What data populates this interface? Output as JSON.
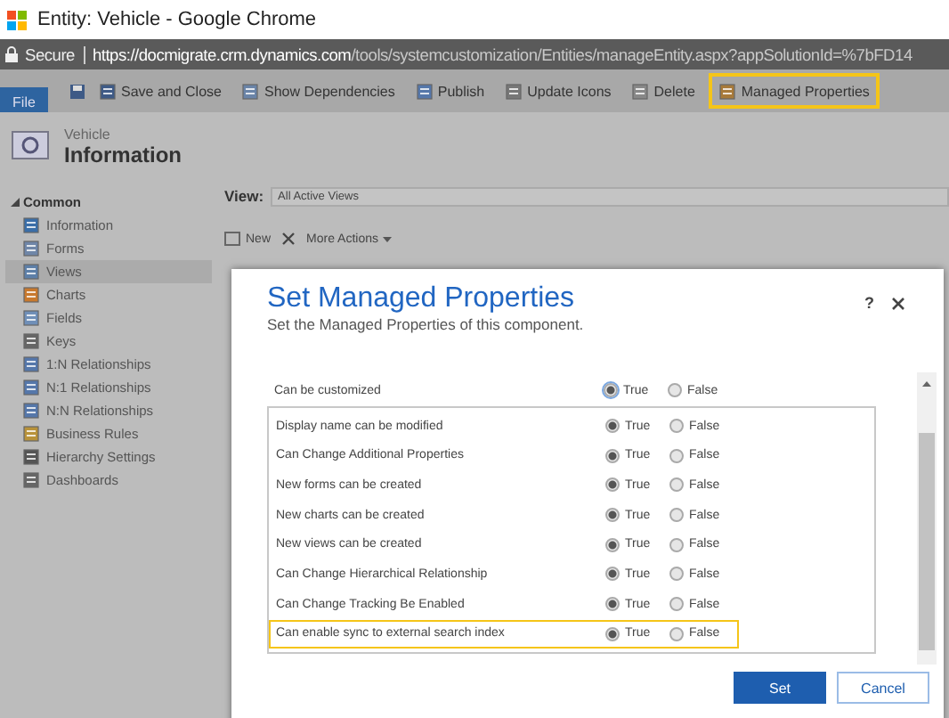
{
  "window": {
    "title": "Entity: Vehicle - Google Chrome"
  },
  "address_bar": {
    "security": "Secure",
    "url_host": "https://docmigrate.crm.dynamics.com",
    "url_path": "/tools/systemcustomization/Entities/manageEntity.aspx?appSolutionId=%7bFD14"
  },
  "ribbon": {
    "file_tab": "File",
    "commands": [
      {
        "label": "Save and Close",
        "highlighted": false
      },
      {
        "label": "Show Dependencies",
        "highlighted": false
      },
      {
        "label": "Publish",
        "highlighted": false
      },
      {
        "label": "Update Icons",
        "highlighted": false
      },
      {
        "label": "Delete",
        "highlighted": false
      },
      {
        "label": "Managed Properties",
        "highlighted": true
      }
    ]
  },
  "header": {
    "entity": "Vehicle",
    "section": "Information"
  },
  "sidebar": {
    "group": "Common",
    "items": [
      {
        "label": "Information",
        "selected": false
      },
      {
        "label": "Forms",
        "selected": false
      },
      {
        "label": "Views",
        "selected": true
      },
      {
        "label": "Charts",
        "selected": false
      },
      {
        "label": "Fields",
        "selected": false
      },
      {
        "label": "Keys",
        "selected": false
      },
      {
        "label": "1:N Relationships",
        "selected": false
      },
      {
        "label": "N:1 Relationships",
        "selected": false
      },
      {
        "label": "N:N Relationships",
        "selected": false
      },
      {
        "label": "Business Rules",
        "selected": false
      },
      {
        "label": "Hierarchy Settings",
        "selected": false
      },
      {
        "label": "Dashboards",
        "selected": false
      }
    ]
  },
  "view_selector": {
    "label": "View:",
    "value": "All Active Views"
  },
  "grid_toolbar": {
    "new": "New",
    "more_actions": "More Actions"
  },
  "dialog": {
    "title": "Set Managed Properties",
    "subtitle": "Set the Managed Properties of this component.",
    "help": "?",
    "customizable": {
      "label": "Can be customized",
      "true_label": "True",
      "false_label": "False",
      "value": true
    },
    "properties": [
      {
        "label": "Display name can be modified",
        "true_label": "True",
        "false_label": "False",
        "value": true,
        "highlighted": false
      },
      {
        "label": "Can Change Additional Properties",
        "true_label": "True",
        "false_label": "False",
        "value": true,
        "highlighted": false
      },
      {
        "label": "New forms can be created",
        "true_label": "True",
        "false_label": "False",
        "value": true,
        "highlighted": false
      },
      {
        "label": "New charts can be created",
        "true_label": "True",
        "false_label": "False",
        "value": true,
        "highlighted": false
      },
      {
        "label": "New views can be created",
        "true_label": "True",
        "false_label": "False",
        "value": true,
        "highlighted": false
      },
      {
        "label": "Can Change Hierarchical Relationship",
        "true_label": "True",
        "false_label": "False",
        "value": true,
        "highlighted": false
      },
      {
        "label": "Can Change Tracking Be Enabled",
        "true_label": "True",
        "false_label": "False",
        "value": true,
        "highlighted": false
      },
      {
        "label": "Can enable sync to external search index",
        "true_label": "True",
        "false_label": "False",
        "value": true,
        "highlighted": true
      }
    ],
    "buttons": [
      {
        "label": "Set",
        "kind": "primary"
      },
      {
        "label": "Cancel",
        "kind": "secondary"
      }
    ]
  }
}
